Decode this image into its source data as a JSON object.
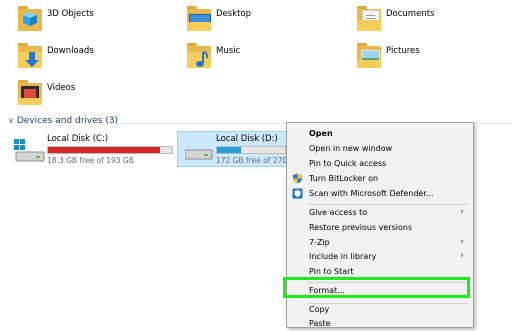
{
  "folders": [
    {
      "label": "3D Objects",
      "icon": "3d-objects-folder-icon"
    },
    {
      "label": "Desktop",
      "icon": "desktop-folder-icon"
    },
    {
      "label": "Documents",
      "icon": "documents-folder-icon"
    },
    {
      "label": "Downloads",
      "icon": "downloads-folder-icon"
    },
    {
      "label": "Music",
      "icon": "music-folder-icon"
    },
    {
      "label": "Pictures",
      "icon": "pictures-folder-icon"
    },
    {
      "label": "Videos",
      "icon": "videos-folder-icon"
    }
  ],
  "devices_group": {
    "title": "Devices and drives (3)",
    "chevron": "chevron-down-icon"
  },
  "drives": [
    {
      "name": "Local Disk (C:)",
      "free": "18.3 GB free of 193 GB",
      "used_fraction": 0.905,
      "bar_color": "#da2626",
      "icon": "windows-drive-icon"
    },
    {
      "name": "Local Disk (D:)",
      "free": "172 GB free of 270 GB",
      "used_fraction": 0.36,
      "bar_color": "#26a0da",
      "icon": "hard-drive-icon"
    }
  ],
  "context_menu": {
    "items": [
      {
        "label": "Open",
        "bold": true
      },
      {
        "label": "Open in new window"
      },
      {
        "label": "Pin to Quick access"
      },
      {
        "label": "Turn BitLocker on",
        "icon": "shield-icon"
      },
      {
        "label": "Scan with Microsoft Defender...",
        "icon": "defender-icon"
      },
      {
        "label": "Give access to",
        "submenu": true
      },
      {
        "label": "Restore previous versions"
      },
      {
        "label": "7-Zip",
        "submenu": true
      },
      {
        "label": "Include in library",
        "submenu": true
      },
      {
        "label": "Pin to Start"
      },
      {
        "label": "Format..."
      },
      {
        "label": "Copy"
      },
      {
        "label": "Paste"
      }
    ]
  },
  "colors": {
    "highlight_box": "#1aed1a",
    "group_header": "#1e3f8a",
    "selection": "#cce8ff"
  }
}
